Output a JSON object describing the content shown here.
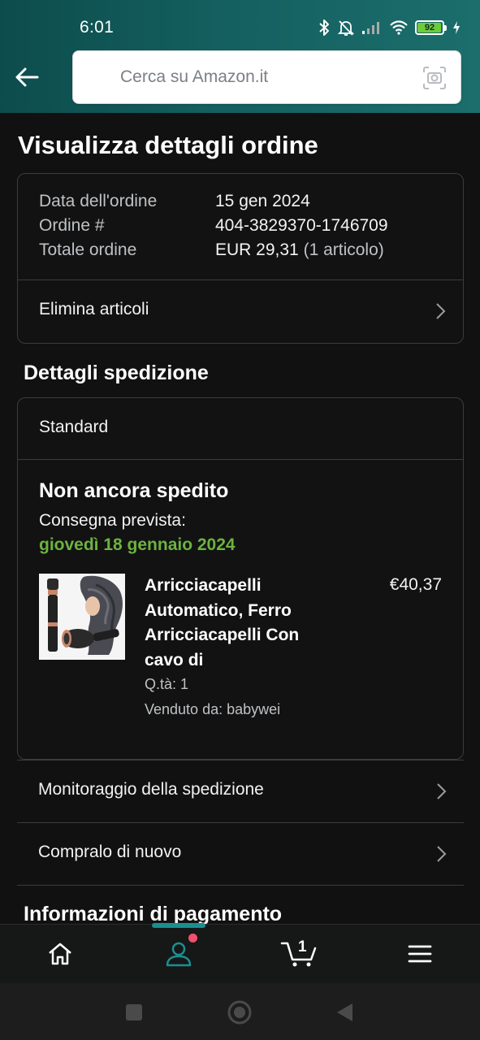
{
  "status_bar": {
    "time": "6:01",
    "battery_level": "92",
    "battery_fill_fraction": 0.92,
    "icons": [
      "bluetooth-icon",
      "bell-off-icon",
      "signal-icon",
      "wifi-icon",
      "battery-icon",
      "charging-icon"
    ]
  },
  "header": {
    "search_placeholder": "Cerca su Amazon.it",
    "back_icon": "arrow-left-icon",
    "camera_icon": "camera-search-icon"
  },
  "page": {
    "title": "Visualizza dettagli ordine"
  },
  "order": {
    "date_label": "Data dell'ordine",
    "date_value": "15 gen 2024",
    "number_label": "Ordine #",
    "number_value": "404-3829370-1746709",
    "total_label": "Totale ordine",
    "total_value": "EUR 29,31",
    "total_items": "(1 articolo)",
    "delete_items_label": "Elimina articoli"
  },
  "shipping": {
    "section_title": "Dettagli spedizione",
    "method": "Standard",
    "status": "Non ancora spedito",
    "delivery_label": "Consegna prevista:",
    "delivery_date": "giovedì 18 gennaio 2024",
    "product": {
      "title": "Arricciacapelli Automatico, Ferro Arricciacapelli Con cavo di",
      "price": "€40,37",
      "quantity": "Q.tà: 1",
      "seller": "Venduto da: babywei"
    },
    "track_label": "Monitoraggio della spedizione",
    "buy_again_label": "Compralo di nuovo"
  },
  "payment": {
    "section_title": "Informazioni di pagamento"
  },
  "bottom_nav": {
    "items": [
      {
        "name": "home",
        "icon": "home-icon"
      },
      {
        "name": "account",
        "icon": "user-icon"
      },
      {
        "name": "cart",
        "icon": "cart-icon"
      },
      {
        "name": "menu",
        "icon": "menu-icon"
      }
    ],
    "cart_count": "1",
    "active": "account"
  },
  "colors": {
    "accent": "#1a8f91",
    "delivery_green": "#6cb33f",
    "notification": "#f0506e",
    "background": "#111111"
  }
}
